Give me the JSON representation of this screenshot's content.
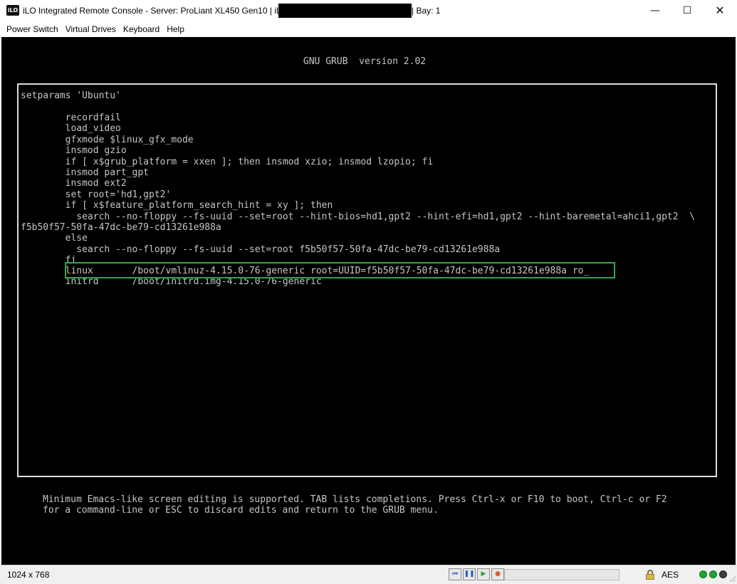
{
  "window": {
    "app_icon_text": "iLO",
    "title": "iLO Integrated Remote Console - Server: ProLiant XL450 Gen10 | iLO:",
    "title_suffix": "| Bay: 1",
    "minimize_glyph": "—",
    "maximize_glyph": "☐",
    "close_glyph": "✕"
  },
  "menu": {
    "items": [
      "Power Switch",
      "Virtual Drives",
      "Keyboard",
      "Help"
    ]
  },
  "console": {
    "grub_title": "GNU GRUB  version 2.02",
    "lines": [
      "setparams 'Ubuntu'",
      "",
      "        recordfail",
      "        load_video",
      "        gfxmode $linux_gfx_mode",
      "        insmod gzio",
      "        if [ x$grub_platform = xxen ]; then insmod xzio; insmod lzopio; fi",
      "        insmod part_gpt",
      "        insmod ext2",
      "        set root='hd1,gpt2'",
      "        if [ x$feature_platform_search_hint = xy ]; then",
      "          search --no-floppy --fs-uuid --set=root --hint-bios=hd1,gpt2 --hint-efi=hd1,gpt2 --hint-baremetal=ahci1,gpt2  \\",
      "f5b50f57-50fa-47dc-be79-cd13261e988a",
      "        else",
      "          search --no-floppy --fs-uuid --set=root f5b50f57-50fa-47dc-be79-cd13261e988a",
      "        fi",
      "        linux       /boot/vmlinuz-4.15.0-76-generic root=UUID=f5b50f57-50fa-47dc-be79-cd13261e988a ro_",
      "        initrd      /boot/initrd.img-4.15.0-76-generic"
    ],
    "help_lines": [
      "Minimum Emacs-like screen editing is supported. TAB lists completions. Press Ctrl-x or F10 to boot, Ctrl-c or F2",
      "for a command-line or ESC to discard edits and return to the GRUB menu."
    ],
    "highlight_color": "#3aa14a"
  },
  "status": {
    "resolution": "1024 x 768",
    "playback_icons": [
      "rewind-icon",
      "pause-icon",
      "play-icon",
      "record-icon"
    ],
    "playback_glyphs": [
      "⏮",
      "❚❚",
      "▶",
      "●"
    ],
    "progress_fraction": 0,
    "encryption": "AES",
    "led_colors": [
      "#1fa532",
      "#1fa532",
      "#3f3f3f"
    ]
  }
}
